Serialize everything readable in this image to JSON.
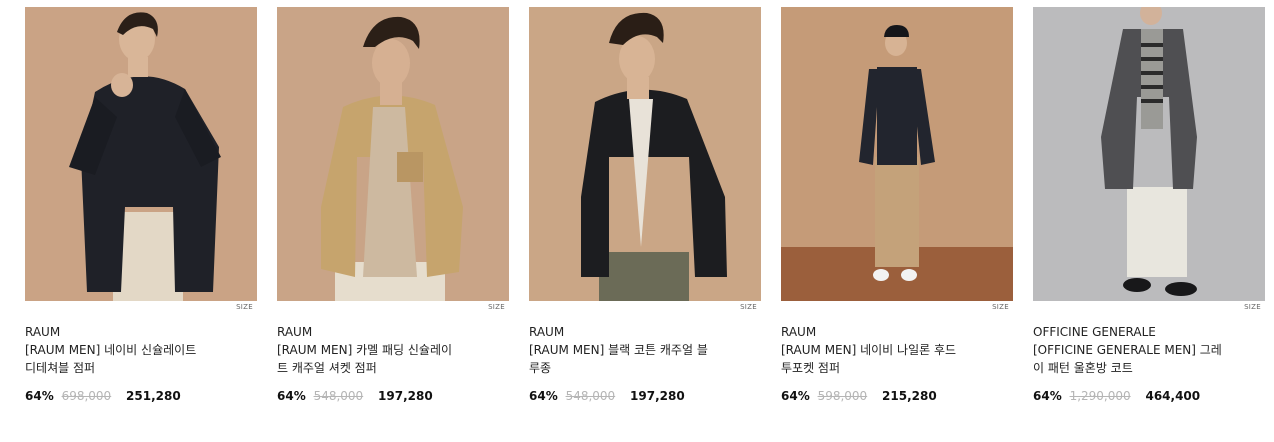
{
  "products": [
    {
      "brand": "RAUM",
      "title_line1": "[RAUM MEN] 네이비 신슐레이트",
      "title_line2": "디테쳐블 점퍼",
      "discount": "64%",
      "original_price": "698,000",
      "sale_price": "251,280",
      "size_label": "SIZE",
      "photo_bg": "#c9a284",
      "garment_color": "#1d1f26"
    },
    {
      "brand": "RAUM",
      "title_line1": "[RAUM MEN] 카멜 패딩 신슐레이",
      "title_line2": "트 캐주얼 셔켓 점퍼",
      "discount": "64%",
      "original_price": "548,000",
      "sale_price": "197,280",
      "size_label": "SIZE",
      "photo_bg": "#c8a386",
      "garment_color": "#c4a26a"
    },
    {
      "brand": "RAUM",
      "title_line1": "[RAUM MEN] 블랙 코튼 캐주얼 블",
      "title_line2": "루종",
      "discount": "64%",
      "original_price": "548,000",
      "sale_price": "197,280",
      "size_label": "SIZE",
      "photo_bg": "#c9a585",
      "garment_color": "#1b1c1f"
    },
    {
      "brand": "RAUM",
      "title_line1": "[RAUM MEN] 네이비 나일론 후드",
      "title_line2": "투포켓 점퍼",
      "discount": "64%",
      "original_price": "598,000",
      "sale_price": "215,280",
      "size_label": "SIZE",
      "photo_bg": "#c49a77",
      "garment_color": "#22252e"
    },
    {
      "brand": "OFFICINE GENERALE",
      "title_line1": "[OFFICINE GENERALE MEN] 그레",
      "title_line2": "이 패턴 울혼방 코트",
      "discount": "64%",
      "original_price": "1,290,000",
      "sale_price": "464,400",
      "size_label": "SIZE",
      "photo_bg": "#b9b9bb",
      "garment_color": "#4e4e50"
    }
  ]
}
